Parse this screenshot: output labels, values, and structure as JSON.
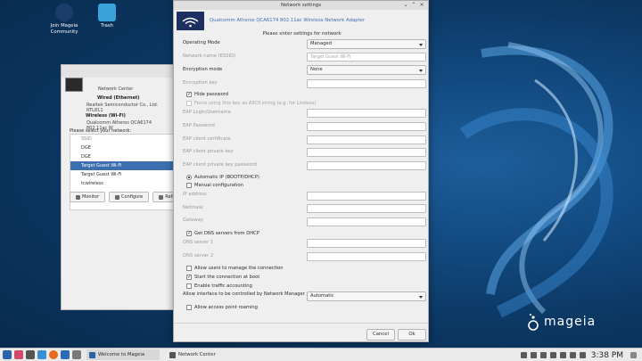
{
  "desktop": {
    "icons": [
      {
        "label": "Join Mageia Community"
      },
      {
        "label": "Trash"
      }
    ],
    "logo_text": "mageia"
  },
  "network_center": {
    "title": "Network Center",
    "wired": {
      "name": "Wired (Ethernet)",
      "desc": "Realtek Semiconductor Co., Ltd. RTL811"
    },
    "wireless": {
      "name": "Wireless (Wi-Fi)",
      "desc": "Qualcomm Atheros QCA6174 802.11ac W"
    },
    "select_prompt": "Please select your network:",
    "list_header": "SSID",
    "networks": [
      "DGE",
      "DGE",
      "Target Guest Wi-Fi",
      "Target Guest Wi-Fi",
      "tcwireless"
    ],
    "selected_index": 2,
    "buttons": [
      "Monitor",
      "Configure",
      "Refresh"
    ]
  },
  "dialog": {
    "title": "Network settings",
    "adapter": "Qualcomm Atheros QCA6174 802.11ac Wireless Network Adapter",
    "prompt": "Please enter settings for network",
    "operating_mode": {
      "label": "Operating Mode",
      "value": "Managed"
    },
    "ssid": {
      "label": "Network name (ESSID)",
      "value": "Target Guest Wi-Fi"
    },
    "encryption_mode": {
      "label": "Encryption mode",
      "value": "None"
    },
    "encryption_key": {
      "label": "Encryption key",
      "value": ""
    },
    "hide_password": {
      "label": "Hide password",
      "checked": true
    },
    "force_ascii": {
      "label": "Force using this key as ASCII string (e.g. for Livebox)",
      "checked": false
    },
    "eap_login": {
      "label": "EAP Login/Username"
    },
    "eap_password": {
      "label": "EAP Password"
    },
    "eap_cert": {
      "label": "EAP client certificate"
    },
    "eap_key": {
      "label": "EAP client private key"
    },
    "eap_key_pass": {
      "label": "EAP client private key password"
    },
    "auto_ip": {
      "label": "Automatic IP (BOOTP/DHCP)",
      "selected": true
    },
    "manual_cfg": {
      "label": "Manual configuration",
      "selected": false
    },
    "ip_address": {
      "label": "IP address"
    },
    "netmask": {
      "label": "Netmask"
    },
    "gateway": {
      "label": "Gateway"
    },
    "dns_dhcp": {
      "label": "Get DNS servers from DHCP",
      "checked": true
    },
    "dns1": {
      "label": "DNS server 1"
    },
    "dns2": {
      "label": "DNS server 2"
    },
    "allow_users": {
      "label": "Allow users to manage the connection",
      "checked": false
    },
    "start_boot": {
      "label": "Start the connection at boot",
      "checked": true
    },
    "traffic": {
      "label": "Enable traffic accounting",
      "checked": false
    },
    "nm_control": {
      "label": "Allow interface to be controlled by Network Manager",
      "value": "Automatic"
    },
    "roaming": {
      "label": "Allow access point roaming",
      "checked": false
    },
    "cancel_label": "Cancel",
    "ok_label": "Ok"
  },
  "taskbar": {
    "tasks": [
      "Welcome to Mageia",
      "Network Center"
    ],
    "clock": "3:38 PM"
  }
}
